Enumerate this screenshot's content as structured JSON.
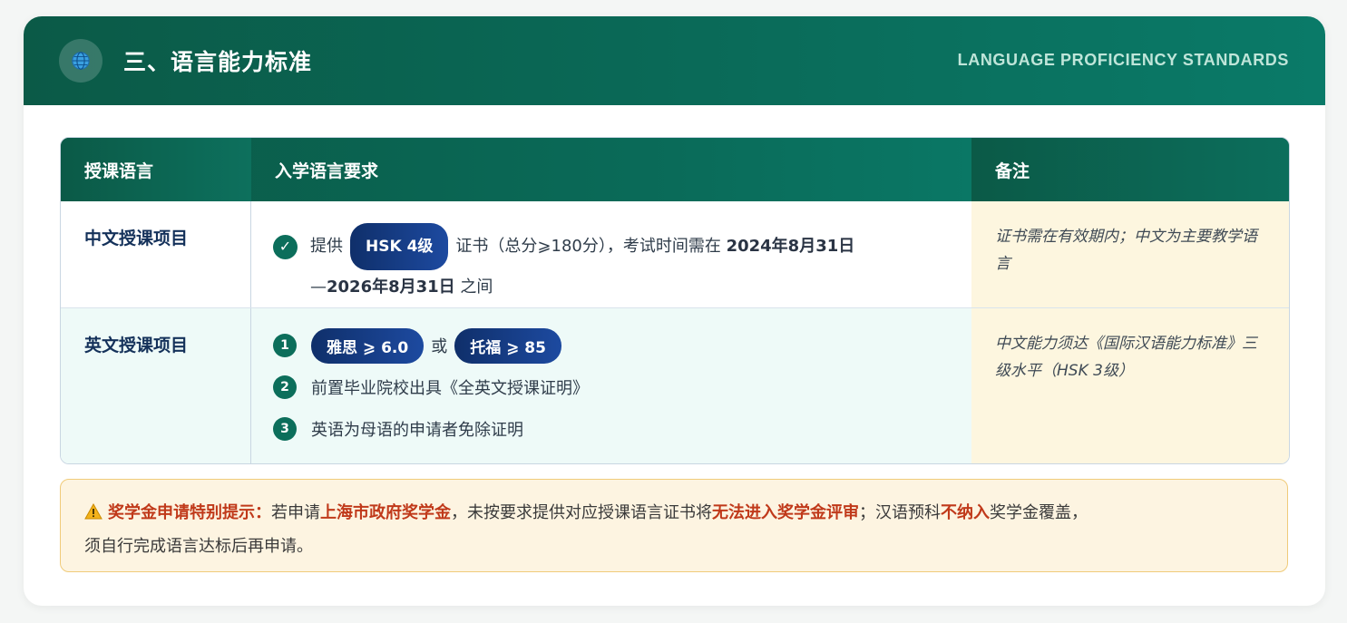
{
  "header": {
    "icon": "globe-icon",
    "title": "三、语言能力标准",
    "subtitle": "LANGUAGE PROFICIENCY STANDARDS"
  },
  "table": {
    "headers": [
      "授课语言",
      "入学语言要求",
      "备注"
    ],
    "rows": [
      {
        "program": "中文授课项目",
        "req_prefix": "提供",
        "req_pill": "HSK 4级",
        "req_mid": "证书（总分⩾180分），考试时间需在",
        "req_date1": "2024年8月31日",
        "req_dash": "—",
        "req_date2": "2026年8月31日",
        "req_suffix": "之间",
        "note": "证书需在有效期内；中文为主要教学语言"
      },
      {
        "program": "英文授课项目",
        "steps": [
          {
            "num": "1",
            "pill1": "雅思 ⩾ 6.0",
            "or": "或",
            "pill2": "托福 ⩾ 85"
          },
          {
            "num": "2",
            "text": "前置毕业院校出具《全英文授课证明》"
          },
          {
            "num": "3",
            "text": "英语为母语的申请者免除证明"
          }
        ],
        "note": "中文能力须达《国际汉语能力标准》三级水平（HSK 3级）"
      }
    ]
  },
  "notice": {
    "icon": "warning-icon",
    "label": "奖学金申请特别提示：",
    "t1": "若申请",
    "h1": "上海市政府奖学金",
    "t2": "，未按要求提供对应授课语言证书将",
    "h2": "无法进入奖学金评审",
    "t3": "；汉语预科",
    "h3": "不纳入",
    "t4": "奖学金覆盖，",
    "t5": "须自行完成语言达标后再申请。"
  },
  "colors": {
    "header_green": "#0b5a47",
    "pill_blue": "#1d4aa0",
    "highlight_red": "#c0391a",
    "note_bg": "#fdf6df"
  }
}
